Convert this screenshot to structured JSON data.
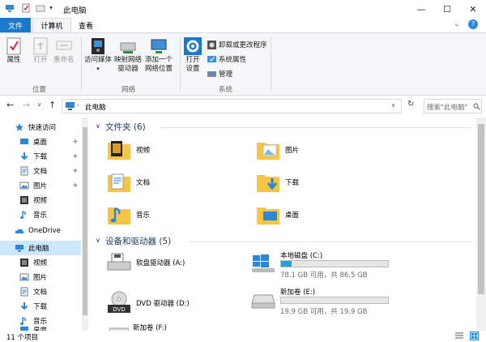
{
  "window": {
    "title": "此电脑",
    "controls": {
      "minimize": "—",
      "maximize": "☐",
      "close": "✕"
    }
  },
  "ribbon": {
    "tabs": {
      "file": "文件",
      "computer": "计算机",
      "view": "查看"
    },
    "help": "?",
    "groups": {
      "location": {
        "label": "位置",
        "properties": "属性",
        "open": "打开",
        "rename": "重命名"
      },
      "network": {
        "label": "网络",
        "media": "访问媒体",
        "map_drive_1": "映射网络",
        "map_drive_2": "驱动器",
        "add_location_1": "添加一个",
        "add_location_2": "网络位置"
      },
      "system": {
        "label": "系统",
        "settings_1": "打开",
        "settings_2": "设置",
        "uninstall": "卸载或更改程序",
        "sysprops": "系统属性",
        "manage": "管理"
      }
    }
  },
  "address": {
    "path": "此电脑",
    "search_placeholder": "搜索\"此电脑\""
  },
  "nav": {
    "items": [
      {
        "label": "快速访问",
        "icon": "star-icon"
      },
      {
        "label": "桌面",
        "icon": "desktop-icon"
      },
      {
        "label": "下载",
        "icon": "download-icon"
      },
      {
        "label": "文档",
        "icon": "document-icon"
      },
      {
        "label": "图片",
        "icon": "picture-icon"
      },
      {
        "label": "视频",
        "icon": "video-icon"
      },
      {
        "label": "音乐",
        "icon": "music-icon"
      },
      {
        "label": "OneDrive",
        "icon": "cloud-icon"
      },
      {
        "label": "此电脑",
        "icon": "computer-icon"
      },
      {
        "label": "视频",
        "icon": "video-icon"
      },
      {
        "label": "图片",
        "icon": "picture-icon"
      },
      {
        "label": "文档",
        "icon": "document-icon"
      },
      {
        "label": "下载",
        "icon": "download-icon"
      },
      {
        "label": "音乐",
        "icon": "music-icon"
      },
      {
        "label": "桌面",
        "icon": "desktop-icon"
      }
    ]
  },
  "content": {
    "folders_header": "文件夹 (6)",
    "folders": [
      {
        "label": "视频",
        "icon": "video-folder-icon"
      },
      {
        "label": "图片",
        "icon": "picture-folder-icon"
      },
      {
        "label": "文档",
        "icon": "document-folder-icon"
      },
      {
        "label": "下载",
        "icon": "download-folder-icon"
      },
      {
        "label": "音乐",
        "icon": "music-folder-icon"
      },
      {
        "label": "桌面",
        "icon": "desktop-folder-icon"
      }
    ],
    "drives_header": "设备和驱动器 (5)",
    "drives": [
      {
        "label": "软盘驱动器 (A:)",
        "icon": "floppy-drive-icon"
      },
      {
        "label": "本地磁盘 (C:)",
        "icon": "windows-drive-icon",
        "free": "78.1 GB 可用，共 86.5 GB",
        "used_fraction": 0.097
      },
      {
        "label": "DVD 驱动器 (D:)",
        "icon": "dvd-drive-icon"
      },
      {
        "label": "新加卷 (E:)",
        "icon": "drive-icon",
        "free": "19.9 GB 可用，共 19.9 GB",
        "used_fraction": 0.0
      },
      {
        "label": "新加卷 (F:)",
        "icon": "drive-icon"
      }
    ]
  },
  "status": {
    "count": "11 个项目"
  },
  "colors": {
    "accent": "#1979ca",
    "folder": "#f5c543",
    "bar": "#26a0da",
    "header": "#1e395b"
  }
}
